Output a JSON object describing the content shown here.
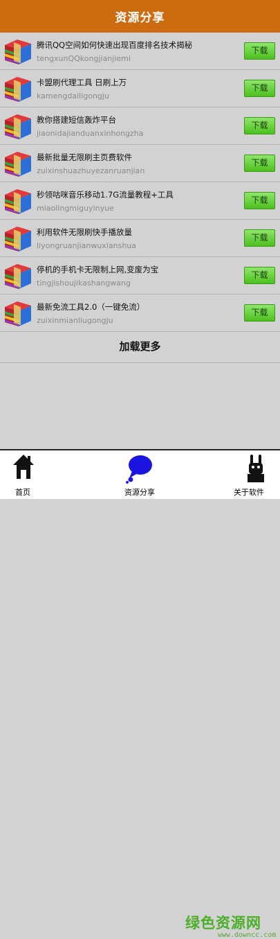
{
  "header": {
    "title": "资源分享"
  },
  "download_label": "下载",
  "items": [
    {
      "title": "腾讯QQ空间如何快速出现百度排名技术揭秘",
      "pinyin": "tengxunQQkongjianjiemi"
    },
    {
      "title": "卡盟刷代理工具 日刷上万",
      "pinyin": "kamengdailigongju"
    },
    {
      "title": "教你搭建短信轰炸平台",
      "pinyin": "jiaonidajianduanxinhongzha"
    },
    {
      "title": "最新批量无限刷主页费软件",
      "pinyin": "zuixinshuazhuyezanruanjian"
    },
    {
      "title": "秒领咕咪音乐移动1.7G流量教程+工具",
      "pinyin": "miaolingmiguyinyue"
    },
    {
      "title": "利用软件无限刷快手播放量",
      "pinyin": "liyongruanjianwuxianshua"
    },
    {
      "title": "停机的手机卡无限制上网,变废为宝",
      "pinyin": "tingjishoujikashangwang"
    },
    {
      "title": "最新免流工具2.0（一键免流）",
      "pinyin": "zuixinmianliugongju"
    }
  ],
  "load_more": "加载更多",
  "tabs": {
    "home": "首页",
    "share": "资源分享",
    "about": "关于软件"
  },
  "watermark": {
    "text": "绿色资源网",
    "url": "www.downcc.com"
  },
  "colors": {
    "header": "#cc6b10",
    "download_button": "#5cc62c",
    "background": "#d2d2d2"
  }
}
